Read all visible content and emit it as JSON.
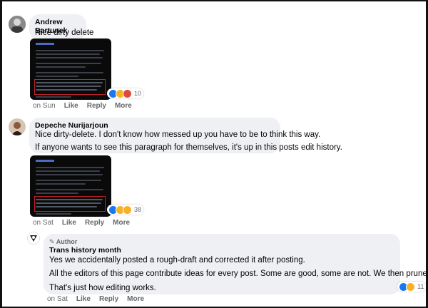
{
  "comments": [
    {
      "author": "Andrew Bartunek",
      "text": "Nice dirty delete",
      "reactions": {
        "count": "10",
        "icons": [
          "like-icon",
          "haha-icon",
          "angry-icon"
        ]
      },
      "time": "on Sun",
      "like": "Like",
      "reply": "Reply",
      "more": "More"
    },
    {
      "author": "Depeche Nurijarjoun",
      "text_line1": "Nice dirty-delete. I don't know how messed up you have to be to think this way.",
      "text_line2": "If anyone wants to see this paragraph for themselves, it's up in this posts edit history.",
      "reactions": {
        "count": "38",
        "icons": [
          "like-icon",
          "haha-icon",
          "care-icon"
        ]
      },
      "time": "on Sat",
      "like": "Like",
      "reply": "Reply",
      "more": "More"
    }
  ],
  "reply": {
    "badge": "Author",
    "author": "Trans history month",
    "para1": "Yes we accidentally posted a rough-draft and corrected it after posting.",
    "para2": "All the editors of this page contribute ideas for every post. Some are good, some are not. We then prune the bad ideas out.",
    "para3": "That's just how editing works.",
    "reactions": {
      "count": "11",
      "icons": [
        "like-icon",
        "haha-icon"
      ]
    },
    "time": "on Sat",
    "like": "Like",
    "reply": "Reply",
    "more": "More"
  },
  "colors": {
    "bubble": "#eef0f3",
    "like_blue": "#1877f2",
    "highlight_red": "#c0202a"
  }
}
